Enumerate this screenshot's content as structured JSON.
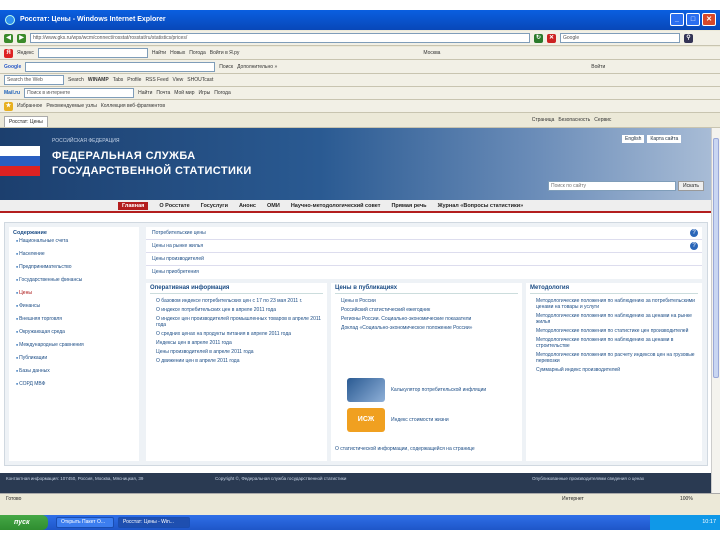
{
  "window": {
    "title": "Росстат: Цены - Windows Internet Explorer"
  },
  "address": {
    "url": "http://www.gks.ru/wps/wcm/connect/rosstat/rosstat/ru/statistics/prices/",
    "search_placeholder": "Google"
  },
  "yandex_bar": {
    "items": [
      "Яндекс",
      "Найти",
      "Новых",
      "Погода",
      "Войти в Я.ру",
      "Москва"
    ]
  },
  "google_bar": {
    "items": [
      "Google",
      "Поиск",
      "Дополнительно »",
      "Войти"
    ]
  },
  "toolbar3": {
    "items": [
      "Search the Web",
      "Search",
      "WINAMP",
      "Tabs",
      "Profile",
      "RSS Feed",
      "View",
      "SHOUTcast"
    ]
  },
  "toolbar4": {
    "items": [
      "Mail.ru",
      "Поиск в интернете",
      "Найти",
      "Почта",
      "Мой мир",
      "Игры",
      "Погода"
    ]
  },
  "links_bar": {
    "items": [
      "Избранное",
      "Рекомендуемые узлы",
      "Коллекция веб-фрагментов"
    ]
  },
  "tab": {
    "label": "Росстат: Цены"
  },
  "commands": {
    "items": [
      "Страница",
      "Безопасность",
      "Сервис"
    ]
  },
  "site": {
    "subtitle": "РОССИЙСКАЯ ФЕДЕРАЦИЯ",
    "title_line1": "ФЕДЕРАЛЬНАЯ СЛУЖБА",
    "title_line2": "ГОСУДАРСТВЕННОЙ СТАТИСТИКИ",
    "lang_links": [
      "English",
      "Карта сайта"
    ],
    "search_placeholder": "Поиск по сайту",
    "search_button": "Искать"
  },
  "nav": {
    "items": [
      "Главная",
      "О Росстате",
      "Госуслуги",
      "Анонс",
      "ОМИ",
      "Научно-методологический совет",
      "Прямая речь",
      "Журнал «Вопросы статистики»"
    ]
  },
  "sidebar": {
    "header": "Содержание",
    "items": [
      "Национальные счета",
      "Население",
      "Предпринимательство",
      "Государственные финансы",
      "Цены",
      "Финансы",
      "Внешняя торговля",
      "Окружающая среда",
      "Международные сравнения",
      "Публикации",
      "Базы данных",
      "СОРД МВФ"
    ]
  },
  "indicators": {
    "rows": [
      "Потребительские цены",
      "Цены на рынке жилья",
      "Цены производителей",
      "Цены приобретения"
    ]
  },
  "col_operational": {
    "title": "Оперативная информация",
    "items": [
      "О базовом индексе потребительских цен с 17 по 23 мая 2011 г.",
      "О индексе потребительских цен в апреле 2011 года",
      "О индексе цен производителей промышленных товаров в апреле 2011 года",
      "О средних ценах на продукты питания в апреле 2011 года",
      "Индексы цен в апреле 2011 года",
      "Цены производителей в апреле 2011 года",
      "О движении цен в апреле 2011 года"
    ]
  },
  "col_publications": {
    "title": "Цены в публикациях",
    "items": [
      "Цены в России",
      "Российский статистический ежегодник",
      "Регионы России. Социально-экономические показатели",
      "Доклад «Социально-экономическое положение России»"
    ],
    "promo1": "Калькулятор потребительской инфляции",
    "promo2": "Индекс стоимости жизни",
    "note": "О статистической информации, содержащейся на странице"
  },
  "col_methodology": {
    "title": "Методология",
    "items": [
      "Методологические положения по наблюдению за потребительскими ценами на товары и услуги",
      "Методологические положения по наблюдению за ценами на рынке жилья",
      "Методологические положения по статистике цен производителей",
      "Методологические положения по наблюдению за ценами в строительстве",
      "Методологические положения по расчету индексов цен на грузовые перевозки",
      "Суммарный индекс производителей"
    ]
  },
  "footer": {
    "left": "Контактная информация: 107450, Россия, Москва, Мясницкая, 39",
    "center": "Copyright ©, Федеральная служба государственной статистики",
    "right": "Опубликованные производителями сведения о ценах"
  },
  "status": {
    "done": "Готово",
    "zone": "Интернет",
    "zoom": "100%"
  },
  "taskbar": {
    "start": "пуск",
    "tasks": [
      "Открыть Пакет О...",
      "Росстат: Цены - Win..."
    ],
    "clock": "10:17"
  }
}
